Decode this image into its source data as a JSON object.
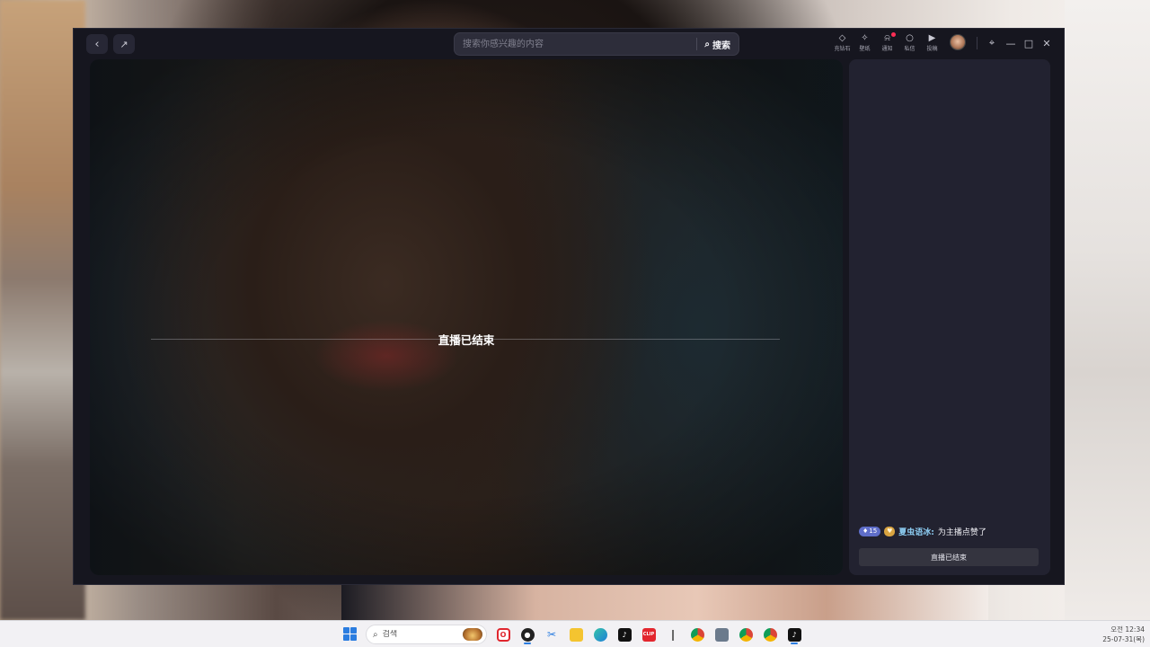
{
  "window": {
    "nav": {
      "back_icon": "chevron-left-icon",
      "share_icon": "share-icon"
    },
    "search": {
      "placeholder": "搜索你感兴趣的内容",
      "button_label": "搜索"
    },
    "top_actions": [
      {
        "label": "充钻石",
        "icon": "diamond-icon"
      },
      {
        "label": "壁纸",
        "icon": "wallpaper-icon"
      },
      {
        "label": "通知",
        "icon": "bell-icon",
        "has_dot": true
      },
      {
        "label": "私信",
        "icon": "chat-bubble-icon"
      },
      {
        "label": "投稿",
        "icon": "upload-icon"
      }
    ],
    "window_controls": [
      "pin-icon",
      "minimize-icon",
      "maximize-icon",
      "close-icon"
    ]
  },
  "player": {
    "status_text": "直播已结束"
  },
  "chat": {
    "messages": [
      {
        "level": "15",
        "user": "夏虫语冰",
        "text": "为主播点赞了"
      }
    ],
    "ended_bar_text": "直播已结束"
  },
  "taskbar": {
    "search_placeholder": "검색",
    "clock_time": "오전 12:34",
    "clock_date": "25-07-31(목)",
    "colors": {
      "start": "#2b7de0",
      "accent": "#2b7de0"
    }
  }
}
